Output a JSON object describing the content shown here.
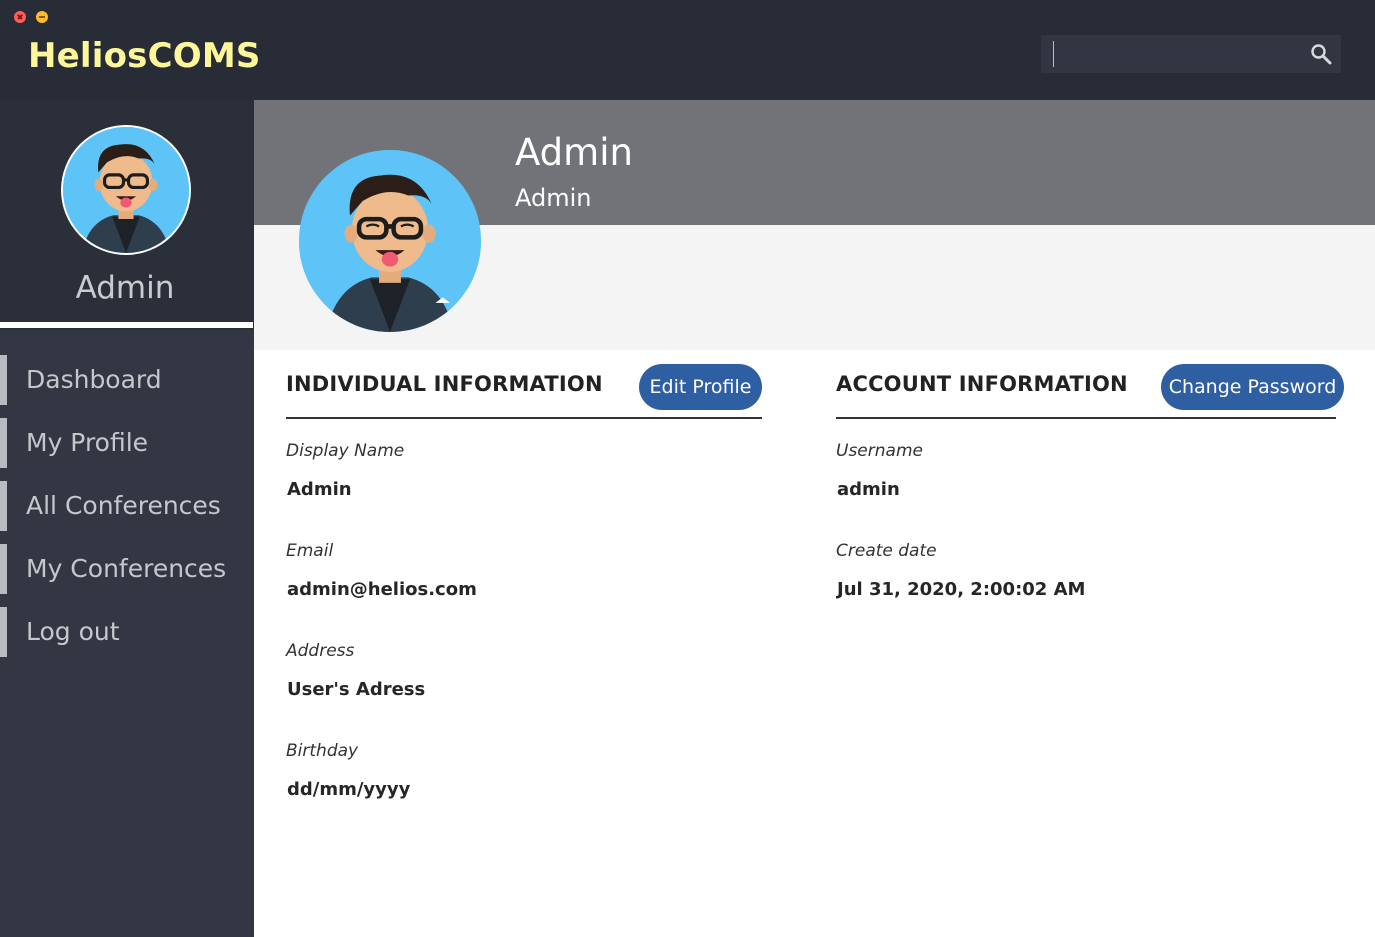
{
  "app": {
    "title": "HeliosCOMS"
  },
  "search": {
    "placeholder": "",
    "value": ""
  },
  "sidebar": {
    "user_name": "Admin",
    "nav": [
      {
        "label": "Dashboard"
      },
      {
        "label": "My Profile"
      },
      {
        "label": "All Conferences"
      },
      {
        "label": "My Conferences"
      },
      {
        "label": "Log out"
      }
    ]
  },
  "profile_header": {
    "name": "Admin",
    "role": "Admin"
  },
  "individual": {
    "title": "INDIVIDUAL INFORMATION",
    "button": "Edit Profile",
    "fields": [
      {
        "label": "Display Name",
        "value": "Admin"
      },
      {
        "label": "Email",
        "value": "admin@helios.com"
      },
      {
        "label": "Address",
        "value": "User's Adress"
      },
      {
        "label": "Birthday",
        "value": "dd/mm/yyyy"
      }
    ]
  },
  "account": {
    "title": "ACCOUNT INFORMATION",
    "button": "Change Password",
    "fields": [
      {
        "label": "Username",
        "value": "admin"
      },
      {
        "label": "Create date",
        "value": "Jul 31, 2020, 2:00:02 AM"
      }
    ]
  },
  "icons": {
    "search": "search-icon",
    "avatar": "avatar",
    "close": "close-icon",
    "minimize": "minimize-icon"
  },
  "colors": {
    "topbar": "#282c37",
    "brand": "#fdf79a",
    "sidebar": "#333744",
    "accent_button": "#2f5fa3",
    "hero": "#717378"
  }
}
